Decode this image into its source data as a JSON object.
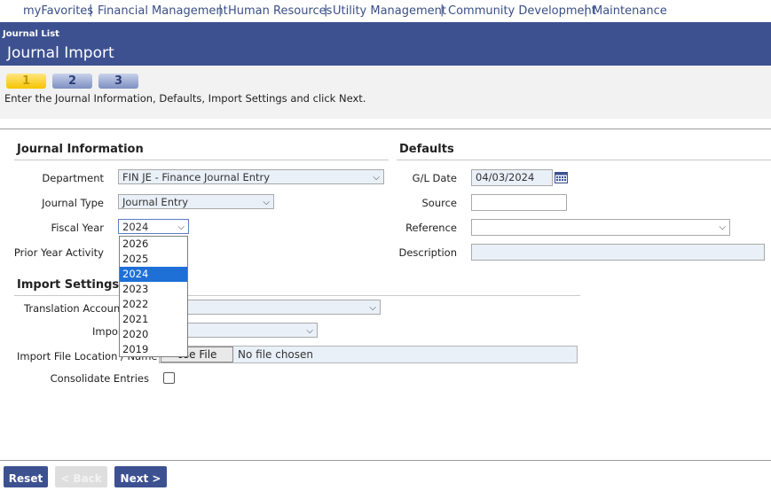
{
  "nav": {
    "items": [
      "myFavorites",
      "Financial Management",
      "Human Resources",
      "Utility Management",
      "Community Development",
      "Maintenance"
    ],
    "separator": "|"
  },
  "header": {
    "breadcrumb": "Journal List",
    "title": "Journal Import"
  },
  "wizard": {
    "steps": [
      "1",
      "2",
      "3"
    ],
    "active_step": "1",
    "instructions": "Enter the Journal Information, Defaults, Import Settings and click Next."
  },
  "journal_info": {
    "title": "Journal Information",
    "department_label": "Department",
    "department_value": "FIN JE - Finance Journal Entry",
    "journal_type_label": "Journal Type",
    "journal_type_value": "Journal Entry",
    "fiscal_year_label": "Fiscal Year",
    "fiscal_year_value": "2024",
    "fiscal_year_options": [
      "2026",
      "2025",
      "2024",
      "2023",
      "2022",
      "2021",
      "2020",
      "2019"
    ],
    "prior_year_label": "Prior Year Activity"
  },
  "defaults": {
    "title": "Defaults",
    "gl_date_label": "G/L Date",
    "gl_date_value": "04/03/2024",
    "source_label": "Source",
    "source_value": "",
    "reference_label": "Reference",
    "reference_value": "",
    "description_label": "Description",
    "description_value": ""
  },
  "import_settings": {
    "title": "Import Settings",
    "translation_label": "Translation Account",
    "import_label": "Impor",
    "file_location_label": "Import File Location / Name",
    "file_button_label": "ose File",
    "file_status": "No file chosen",
    "consolidate_label": "Consolidate Entries",
    "consolidate_checked": false
  },
  "buttons": {
    "reset": "Reset",
    "back": "< Back",
    "next": "Next >"
  },
  "colors": {
    "header_bg": "#3d5191",
    "nav_text": "#3a4f86",
    "step_active": "#f5c400",
    "selected_option": "#1e6fd6"
  }
}
